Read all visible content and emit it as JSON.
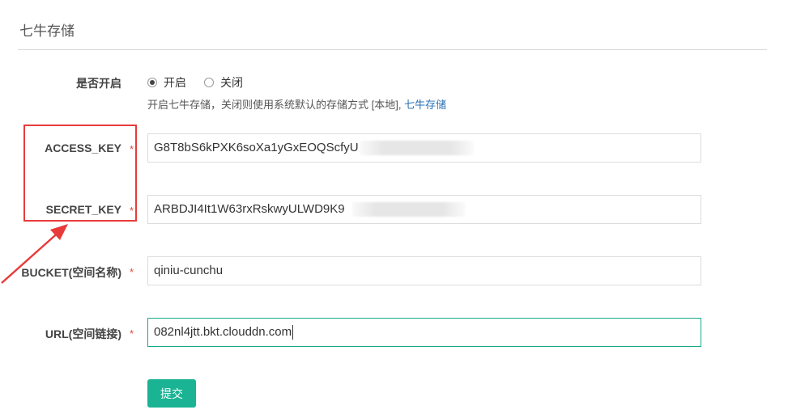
{
  "section": {
    "title": "七牛存储"
  },
  "enable": {
    "label": "是否开启",
    "options": [
      {
        "label": "开启",
        "checked": true
      },
      {
        "label": "关闭",
        "checked": false
      }
    ],
    "help_text": "开启七牛存储，关闭则使用系统默认的存储方式 [本地],",
    "help_link": "七牛存储"
  },
  "fields": {
    "access_key": {
      "label": "ACCESS_KEY",
      "required": "*",
      "value": "G8T8bS6kPXK6soXa1yGxEOQScfyU"
    },
    "secret_key": {
      "label": "SECRET_KEY",
      "required": "*",
      "value": "ARBDJI4It1W63rxRskwyULWD9K9"
    },
    "bucket": {
      "label": "BUCKET(空间名称)",
      "required": "*",
      "value": "qiniu-cunchu"
    },
    "url": {
      "label": "URL(空间链接)",
      "required": "*",
      "value": "082nl4jtt.bkt.clouddn.com"
    }
  },
  "submit": {
    "label": "提交"
  },
  "colors": {
    "accent": "#1ab394",
    "required": "#e04a3b",
    "link": "#2a6fb5",
    "annotation": "#e83b3b"
  }
}
